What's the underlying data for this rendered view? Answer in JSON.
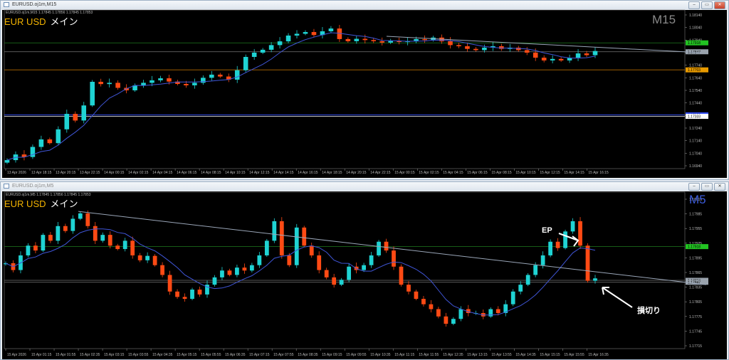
{
  "windows": [
    {
      "title": "EURUSD.oj1m,M15",
      "ohlc": "EURUSD.oj1m,M15  1.17845 1.17856 1.17845 1.17853",
      "symbol": "EUR USD",
      "symbol_jp": "メイン",
      "timeframe": "M15",
      "timeframe_color": "#8a8a8a"
    },
    {
      "title": "EURUSD.oj1m,M5",
      "ohlc": "EURUSD.oj1m,M5  1.17845 1.17856 1.17845 1.17853",
      "symbol": "EUR USD",
      "symbol_jp": "メイン",
      "timeframe": "M5",
      "timeframe_color": "#3b5bdb"
    }
  ],
  "window_buttons": {
    "minimize": "–",
    "restore": "▭",
    "close": "✕"
  },
  "annotations": {
    "ep": "EP",
    "stop_loss": "損切り"
  },
  "colors": {
    "bull": "#1fd3d3",
    "bear": "#ff4a14",
    "ma": "#3f55d6",
    "trend": "#9aa6b8",
    "green_line": "#1f7a1f",
    "orange_line": "#b36b00",
    "blue_line": "#3550ff"
  },
  "chart_data": [
    {
      "type": "candlestick",
      "title": "EURUSD.oj1m,M15",
      "ylim": [
        1.1694,
        1.1814
      ],
      "yticks": [
        "1.18140",
        "1.18040",
        "1.17940",
        "1.17840",
        "1.17740",
        "1.17640",
        "1.17540",
        "1.17440",
        "1.17340",
        "1.17240",
        "1.17140",
        "1.17040",
        "1.16940"
      ],
      "xticks": [
        "13 Apr 2026",
        "13 Apr 18:15",
        "13 Apr 20:15",
        "13 Apr 22:15",
        "14 Apr 00:15",
        "14 Apr 02:15",
        "14 Apr 04:15",
        "14 Apr 06:15",
        "14 Apr 08:15",
        "14 Apr 10:15",
        "14 Apr 12:15",
        "14 Apr 14:15",
        "14 Apr 16:15",
        "14 Apr 18:15",
        "14 Apr 20:15",
        "14 Apr 22:15",
        "15 Apr 00:15",
        "15 Apr 02:15",
        "15 Apr 04:15",
        "15 Apr 06:15",
        "15 Apr 08:15",
        "15 Apr 10:15",
        "15 Apr 12:15",
        "15 Apr 14:15",
        "15 Apr 16:15"
      ],
      "closes": [
        1.16985,
        1.1703,
        1.1701,
        1.1709,
        1.1715,
        1.1712,
        1.1723,
        1.17353,
        1.173,
        1.1742,
        1.17608,
        1.1759,
        1.176,
        1.1756,
        1.1754,
        1.1758,
        1.176,
        1.1762,
        1.17636,
        1.1761,
        1.17591,
        1.1758,
        1.176,
        1.1764,
        1.17665,
        1.1765,
        1.17625,
        1.177,
        1.17806,
        1.1784,
        1.17863,
        1.179,
        1.1793,
        1.17976,
        1.1799,
        1.18004,
        1.1798,
        1.1801,
        1.18032,
        1.17948,
        1.17931,
        1.1795,
        1.1794,
        1.17931,
        1.1792,
        1.17935,
        1.17925,
        1.1793,
        1.17948,
        1.1794,
        1.1796,
        1.1793,
        1.179,
        1.17891,
        1.1787,
        1.1786,
        1.1788,
        1.17891,
        1.1787,
        1.1788,
        1.1786,
        1.1784,
        1.178,
        1.17778,
        1.1779,
        1.17778,
        1.178,
        1.17834,
        1.1782,
        1.17853
      ],
      "hlines": [
        {
          "price": 1.17918,
          "label": "1.17918",
          "color": "#1f7a1f",
          "tag": "#22c322"
        },
        {
          "price": 1.17847,
          "label": "1.17847",
          "color": "#777777",
          "tag": "#9aa3ad"
        },
        {
          "price": 1.17703,
          "label": "1.17703",
          "color": "#b36b00",
          "tag": "#e89a00"
        },
        {
          "price": 1.17345,
          "label": "1.17355",
          "color": "#3550ff",
          "tag": "#3550ff"
        },
        {
          "price": 1.17333,
          "label": "1.17333",
          "color": "#dddddd",
          "tag": "#ffffff"
        }
      ],
      "trendline": [
        [
          1.1797,
          0.63
        ],
        [
          1.1784,
          1.0
        ]
      ]
    },
    {
      "type": "candlestick",
      "title": "EURUSD.oj1m,M5",
      "ylim": [
        1.17715,
        1.18015
      ],
      "yticks": [
        "1.18015",
        "1.17985",
        "1.17955",
        "1.17925",
        "1.17895",
        "1.17865",
        "1.17835",
        "1.17805",
        "1.17775",
        "1.17745",
        "1.17715"
      ],
      "xticks": [
        "15 Apr 2026",
        "15 Apr 01:15",
        "15 Apr 01:55",
        "15 Apr 02:35",
        "15 Apr 03:15",
        "15 Apr 03:55",
        "15 Apr 04:35",
        "15 Apr 05:15",
        "15 Apr 05:55",
        "15 Apr 06:35",
        "15 Apr 07:15",
        "15 Apr 07:55",
        "15 Apr 08:35",
        "15 Apr 09:15",
        "15 Apr 09:55",
        "15 Apr 10:35",
        "15 Apr 11:15",
        "15 Apr 11:55",
        "15 Apr 12:35",
        "15 Apr 13:15",
        "15 Apr 13:55",
        "15 Apr 14:35",
        "15 Apr 15:15",
        "15 Apr 15:55",
        "15 Apr 16:35"
      ],
      "closes": [
        1.17884,
        1.1787,
        1.179,
        1.1792,
        1.1791,
        1.17942,
        1.1793,
        1.1796,
        1.1795,
        1.17975,
        1.17986,
        1.1796,
        1.1793,
        1.17942,
        1.1792,
        1.17913,
        1.1793,
        1.179,
        1.1789,
        1.17899,
        1.1788,
        1.1786,
        1.17826,
        1.17815,
        1.17811,
        1.1783,
        1.1782,
        1.1784,
        1.17855,
        1.17869,
        1.1786,
        1.17875,
        1.17869,
        1.1788,
        1.179,
        1.1793,
        1.1797,
        1.179,
        1.1788,
        1.17957,
        1.1792,
        1.179,
        1.1787,
        1.17855,
        1.1784,
        1.1785,
        1.17877,
        1.1787,
        1.1788,
        1.179,
        1.17928,
        1.1791,
        1.17877,
        1.1784,
        1.17826,
        1.17811,
        1.178,
        1.1779,
        1.17775,
        1.1776,
        1.1777,
        1.1779,
        1.17782,
        1.17782,
        1.17775,
        1.1779,
        1.17782,
        1.178,
        1.17826,
        1.1784,
        1.1786,
        1.1788,
        1.179,
        1.17928,
        1.17915,
        1.17949,
        1.1797,
        1.1792,
        1.17848,
        1.17853
      ],
      "hlines": [
        {
          "price": 1.17918,
          "label": "1.17918",
          "color": "#1f7a1f",
          "tag": "#22c322"
        },
        {
          "price": 1.17849,
          "label": "1.17853",
          "color": "#777777",
          "tag": "#9aa3ad"
        },
        {
          "price": 1.17845,
          "label": "1.17847",
          "color": "#777777",
          "tag": "#9aa3ad"
        }
      ],
      "trendline": [
        [
          1.1799,
          0.11
        ],
        [
          1.1784,
          1.0
        ]
      ]
    }
  ]
}
